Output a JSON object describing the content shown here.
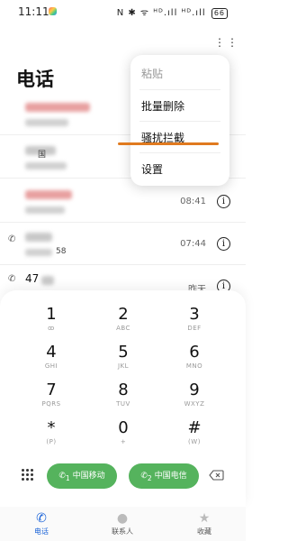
{
  "status_bar": {
    "time": "11:11",
    "icons": "N ✱ ᯤ ᴴᴰ.ıll ᴴᴰ.ıll",
    "battery": "66"
  },
  "header": {
    "title": "电话",
    "more_icon": "⋮⋮"
  },
  "call_log": [
    {
      "time": "",
      "number_suffix": "",
      "name_color": "#e8a0a0",
      "name_width": 72,
      "num_width": 48
    },
    {
      "time": "",
      "number_suffix": "国",
      "name_color": "#c8c8c8",
      "name_width": 34,
      "num_width": 46
    },
    {
      "time": "08:41",
      "number_suffix": "",
      "name_color": "#e8a0a0",
      "name_width": 52,
      "num_width": 44
    },
    {
      "time": "07:44",
      "number_suffix": "58",
      "name_color": "#c8c8c8",
      "name_width": 30,
      "num_width": 30
    },
    {
      "time": "昨天",
      "number_suffix": "",
      "name_color": "#c8c8c8",
      "name_width": 14,
      "num_width": 0,
      "name_prefix": "47"
    }
  ],
  "menu": {
    "items": [
      {
        "label": "粘贴",
        "enabled": false
      },
      {
        "label": "批量删除",
        "enabled": true
      },
      {
        "label": "骚扰拦截",
        "enabled": true
      },
      {
        "label": "设置",
        "enabled": true
      }
    ],
    "highlight_color": "#e07a1f"
  },
  "dialpad": {
    "keys": [
      {
        "digit": "1",
        "sub": "ꝏ"
      },
      {
        "digit": "2",
        "sub": "ABC"
      },
      {
        "digit": "3",
        "sub": "DEF"
      },
      {
        "digit": "4",
        "sub": "GHI"
      },
      {
        "digit": "5",
        "sub": "JKL"
      },
      {
        "digit": "6",
        "sub": "MNO"
      },
      {
        "digit": "7",
        "sub": "PQRS"
      },
      {
        "digit": "8",
        "sub": "TUV"
      },
      {
        "digit": "9",
        "sub": "WXYZ"
      },
      {
        "digit": "*",
        "sub": "(P)"
      },
      {
        "digit": "0",
        "sub": "+"
      },
      {
        "digit": "#",
        "sub": "(W)"
      }
    ],
    "sim1_label": "中国移动",
    "sim2_label": "中国电信",
    "sim1_index": "1",
    "sim2_index": "2",
    "call_color": "#55b35d"
  },
  "nav": {
    "items": [
      {
        "label": "电话",
        "icon": "phone-icon",
        "active": true
      },
      {
        "label": "联系人",
        "icon": "contacts-icon",
        "active": false
      },
      {
        "label": "收藏",
        "icon": "star-icon",
        "active": false
      }
    ],
    "accent": "#1a63d8"
  }
}
